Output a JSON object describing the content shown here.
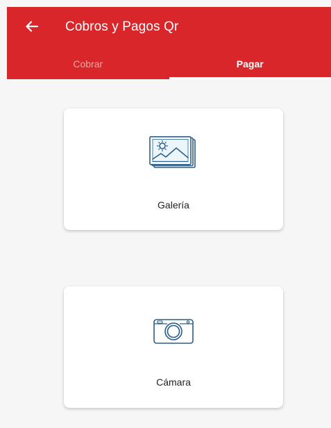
{
  "header": {
    "title": "Cobros y Pagos Qr",
    "back_icon": "arrow-left-icon"
  },
  "tabs": [
    {
      "label": "Cobrar",
      "active": false
    },
    {
      "label": "Pagar",
      "active": true
    }
  ],
  "options": {
    "gallery": {
      "label": "Galería",
      "icon": "image-gallery-icon"
    },
    "camera": {
      "label": "Cámara",
      "icon": "camera-icon"
    }
  },
  "colors": {
    "primary": "#d9262b",
    "tab_inactive": "#f3a3a5",
    "icon_stroke": "#2f5d83",
    "background": "#f6f6f6"
  }
}
